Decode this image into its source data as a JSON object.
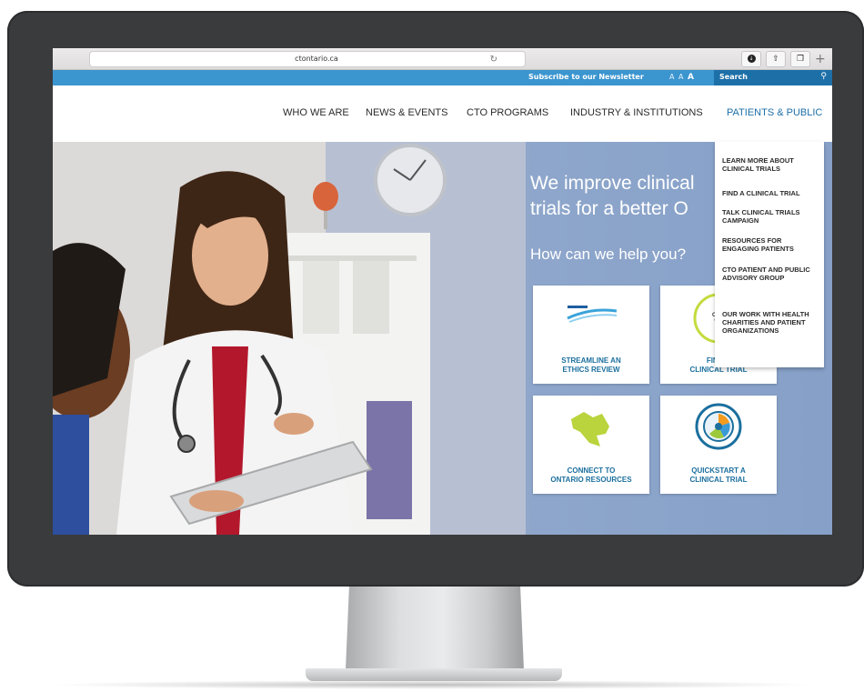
{
  "browser": {
    "url": "ctontario.ca"
  },
  "utility_bar": {
    "newsletter": "Subscribe to our Newsletter",
    "font_small": "A A",
    "font_large": "A",
    "search_placeholder": "Search"
  },
  "nav": {
    "items": [
      "WHO WE ARE",
      "NEWS & EVENTS",
      "CTO PROGRAMS",
      "INDUSTRY & INSTITUTIONS",
      "PATIENTS & PUBLIC"
    ]
  },
  "hero": {
    "headline_line1": "We improve clinical",
    "headline_line2": "trials for a better O",
    "subheading": "How can we help you?"
  },
  "tiles": [
    {
      "label_line1": "STREAMLINE AN",
      "label_line2": "ETHICS REVIEW",
      "icon": "cto-stream-logo"
    },
    {
      "label_line1": "FIND A",
      "label_line2": "CLINICAL TRIAL",
      "icon": "clinical-trials-finder-logo"
    },
    {
      "label_line1": "CONNECT TO",
      "label_line2": "ONTARIO RESOURCES",
      "icon": "ontario-map-icon"
    },
    {
      "label_line1": "QUICKSTART A",
      "label_line2": "CLINICAL TRIAL",
      "icon": "quickstart-badge-icon"
    }
  ],
  "dropdown": {
    "items": [
      "LEARN MORE ABOUT CLINICAL TRIALS",
      "FIND A CLINICAL TRIAL",
      "TALK CLINICAL TRIALS CAMPAIGN",
      "RESOURCES FOR ENGAGING PATIENTS",
      "CTO PATIENT AND PUBLIC ADVISORY GROUP",
      "OUR WORK WITH HEALTH CHARITIES AND PATIENT ORGANIZATIONS"
    ]
  },
  "colors": {
    "utility_bar": "#3b95cf",
    "search_bg": "#1d6fa8",
    "tile_text": "#1b6f9e",
    "bezel": "#3a3b3d"
  }
}
